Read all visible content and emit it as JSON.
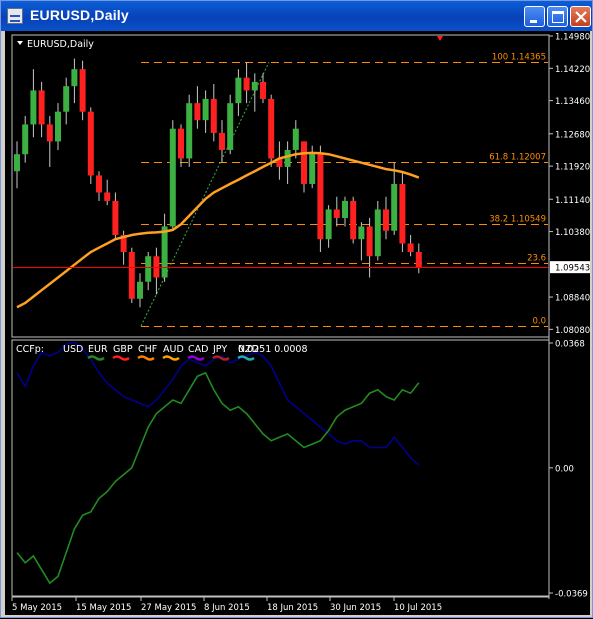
{
  "window": {
    "title": "EURUSD,Daily",
    "buttons": {
      "minimize": "minimize-button",
      "maximize": "maximize-button",
      "close": "close-button"
    }
  },
  "main_panel": {
    "label": "EURUSD,Daily",
    "price_scale": [
      "1.14980",
      "1.14220",
      "1.13460",
      "1.12680",
      "1.11920",
      "1.11140",
      "1.10380",
      "1.09543",
      "1.08840",
      "1.08080"
    ],
    "current_price": "1.09543",
    "fib_labels": [
      "100  1.14365",
      "61.8  1.12007",
      "38.2  1.10549",
      "23.6",
      "0.0"
    ]
  },
  "indicator_panel": {
    "label": "CCFp:",
    "legend": [
      {
        "name": "USD",
        "color": "#000000"
      },
      {
        "name": "EUR",
        "color": "#228b22"
      },
      {
        "name": "GBP",
        "color": "#ff2020"
      },
      {
        "name": "CHF",
        "color": "#ff7f00"
      },
      {
        "name": "AUD",
        "color": "#ffa500"
      },
      {
        "name": "CAD",
        "color": "#9400d3"
      },
      {
        "name": "JPY",
        "color": "#b22222"
      },
      {
        "name": "NZD",
        "color": "#20b2aa"
      }
    ],
    "values": "0.0251 0.0008",
    "scale": [
      "0.0368",
      "0.00",
      "-0.0369"
    ]
  },
  "time_axis": [
    "5 May 2015",
    "15 May 2015",
    "27 May 2015",
    "8 Jun 2015",
    "18 Jun 2015",
    "30 Jun 2015",
    "10 Jul 2015"
  ],
  "colors": {
    "bull": "#3cb043",
    "bear": "#ff2020",
    "ma": "#ffa020",
    "fib": "#ff8c00",
    "bid_line": "#ff0000"
  },
  "chart_data": {
    "type": "candlestick",
    "symbol": "EURUSD",
    "timeframe": "Daily",
    "candles": [
      [
        1.118,
        1.125,
        1.114,
        1.122
      ],
      [
        1.122,
        1.131,
        1.12,
        1.129
      ],
      [
        1.129,
        1.142,
        1.126,
        1.137
      ],
      [
        1.137,
        1.139,
        1.126,
        1.129
      ],
      [
        1.129,
        1.131,
        1.119,
        1.125
      ],
      [
        1.125,
        1.134,
        1.123,
        1.132
      ],
      [
        1.132,
        1.14,
        1.129,
        1.138
      ],
      [
        1.138,
        1.1445,
        1.134,
        1.142
      ],
      [
        1.142,
        1.144,
        1.13,
        1.132
      ],
      [
        1.132,
        1.133,
        1.115,
        1.117
      ],
      [
        1.117,
        1.118,
        1.111,
        1.113
      ],
      [
        1.113,
        1.116,
        1.11,
        1.111
      ],
      [
        1.111,
        1.113,
        1.102,
        1.103
      ],
      [
        1.103,
        1.104,
        1.096,
        1.099
      ],
      [
        1.099,
        1.1,
        1.087,
        1.088
      ],
      [
        1.088,
        1.094,
        1.086,
        1.092
      ],
      [
        1.092,
        1.099,
        1.09,
        1.098
      ],
      [
        1.098,
        1.1,
        1.089,
        1.093
      ],
      [
        1.093,
        1.108,
        1.092,
        1.105
      ],
      [
        1.105,
        1.13,
        1.104,
        1.128
      ],
      [
        1.128,
        1.129,
        1.119,
        1.121
      ],
      [
        1.121,
        1.136,
        1.119,
        1.134
      ],
      [
        1.134,
        1.138,
        1.128,
        1.13
      ],
      [
        1.13,
        1.137,
        1.127,
        1.135
      ],
      [
        1.135,
        1.1385,
        1.125,
        1.127
      ],
      [
        1.127,
        1.13,
        1.12,
        1.123
      ],
      [
        1.123,
        1.136,
        1.122,
        1.134
      ],
      [
        1.134,
        1.142,
        1.131,
        1.14
      ],
      [
        1.14,
        1.1437,
        1.134,
        1.137
      ],
      [
        1.137,
        1.141,
        1.132,
        1.139
      ],
      [
        1.139,
        1.141,
        1.134,
        1.135
      ],
      [
        1.135,
        1.136,
        1.119,
        1.121
      ],
      [
        1.121,
        1.125,
        1.116,
        1.119
      ],
      [
        1.119,
        1.125,
        1.115,
        1.123
      ],
      [
        1.123,
        1.13,
        1.121,
        1.128
      ],
      [
        1.125,
        1.125,
        1.113,
        1.115
      ],
      [
        1.115,
        1.124,
        1.114,
        1.122
      ],
      [
        1.122,
        1.124,
        1.099,
        1.102
      ],
      [
        1.102,
        1.11,
        1.1,
        1.109
      ],
      [
        1.109,
        1.112,
        1.105,
        1.107
      ],
      [
        1.107,
        1.112,
        1.105,
        1.111
      ],
      [
        1.111,
        1.112,
        1.101,
        1.102
      ],
      [
        1.102,
        1.106,
        1.097,
        1.105
      ],
      [
        1.105,
        1.107,
        1.093,
        1.098
      ],
      [
        1.098,
        1.111,
        1.097,
        1.109
      ],
      [
        1.109,
        1.112,
        1.102,
        1.104
      ],
      [
        1.104,
        1.12,
        1.103,
        1.115
      ],
      [
        1.115,
        1.118,
        1.099,
        1.101
      ],
      [
        1.101,
        1.103,
        1.098,
        1.099
      ],
      [
        1.099,
        1.101,
        1.094,
        1.0954
      ]
    ],
    "moving_average": [
      1.086,
      1.087,
      1.0885,
      1.09,
      1.0915,
      1.093,
      1.0945,
      1.096,
      1.0975,
      1.099,
      1.1,
      1.101,
      1.102,
      1.1025,
      1.103,
      1.1033,
      1.1035,
      1.1036,
      1.1038,
      1.1042,
      1.1055,
      1.1075,
      1.1095,
      1.1115,
      1.113,
      1.114,
      1.115,
      1.116,
      1.117,
      1.118,
      1.119,
      1.12,
      1.121,
      1.1215,
      1.122,
      1.1222,
      1.1223,
      1.1222,
      1.122,
      1.1215,
      1.121,
      1.1205,
      1.12,
      1.1195,
      1.119,
      1.1185,
      1.1182,
      1.1178,
      1.1172,
      1.1165
    ],
    "fibonacci": [
      {
        "level": "100",
        "price": 1.14365
      },
      {
        "level": "61.8",
        "price": 1.12007
      },
      {
        "level": "38.2",
        "price": 1.10549
      },
      {
        "level": "23.6",
        "price": 1.0964
      },
      {
        "level": "0.0",
        "price": 1.0816
      }
    ],
    "bid": 1.09543,
    "ylim": [
      1.079,
      1.1498
    ],
    "indicator": {
      "ylim": [
        -0.0369,
        0.0368
      ],
      "series": [
        {
          "name": "USD",
          "color": "#00008b",
          "values": [
            0.028,
            0.024,
            0.03,
            0.034,
            0.033,
            0.034,
            0.0365,
            0.037,
            0.035,
            0.032,
            0.028,
            0.025,
            0.023,
            0.021,
            0.02,
            0.019,
            0.018,
            0.02,
            0.023,
            0.026,
            0.03,
            0.032,
            0.031,
            0.03,
            0.032,
            0.033,
            0.031,
            0.032,
            0.033,
            0.034,
            0.033,
            0.03,
            0.025,
            0.02,
            0.018,
            0.016,
            0.014,
            0.012,
            0.01,
            0.008,
            0.007,
            0.008,
            0.008,
            0.006,
            0.006,
            0.006,
            0.009,
            0.006,
            0.003,
            0.0008
          ]
        },
        {
          "name": "EUR",
          "color": "#228b22",
          "values": [
            -0.025,
            -0.028,
            -0.026,
            -0.03,
            -0.034,
            -0.032,
            -0.025,
            -0.018,
            -0.014,
            -0.013,
            -0.009,
            -0.007,
            -0.004,
            -0.002,
            0.0,
            0.006,
            0.012,
            0.016,
            0.018,
            0.02,
            0.019,
            0.023,
            0.027,
            0.028,
            0.023,
            0.019,
            0.017,
            0.018,
            0.016,
            0.013,
            0.01,
            0.008,
            0.009,
            0.01,
            0.008,
            0.006,
            0.007,
            0.008,
            0.011,
            0.015,
            0.017,
            0.018,
            0.019,
            0.022,
            0.023,
            0.021,
            0.02,
            0.023,
            0.022,
            0.0251
          ]
        }
      ]
    }
  }
}
